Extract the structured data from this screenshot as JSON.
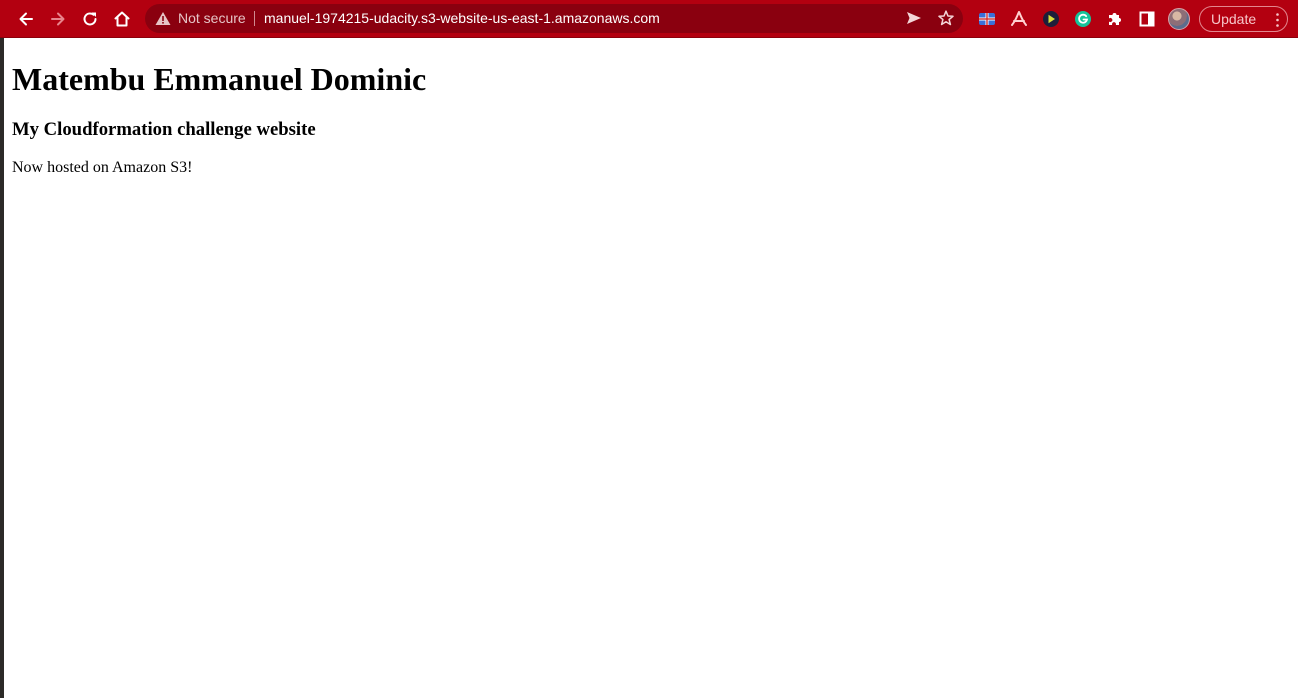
{
  "browser": {
    "security_label": "Not secure",
    "url": "manuel-1974215-udacity.s3-website-us-east-1.amazonaws.com",
    "update_label": "Update",
    "theme_color": "#b30010",
    "icons": {
      "back": "arrow-left-icon",
      "forward": "arrow-right-icon",
      "reload": "reload-icon",
      "home": "home-icon",
      "security": "warning-icon",
      "send": "send-icon",
      "bookmark": "star-icon",
      "extensions": "puzzle-icon",
      "side_panel": "side-panel-icon",
      "menu": "kebab-icon"
    }
  },
  "page": {
    "heading": "Matembu Emmanuel Dominic",
    "subheading": "My Cloudformation challenge website",
    "body_text": "Now hosted on Amazon S3!"
  }
}
